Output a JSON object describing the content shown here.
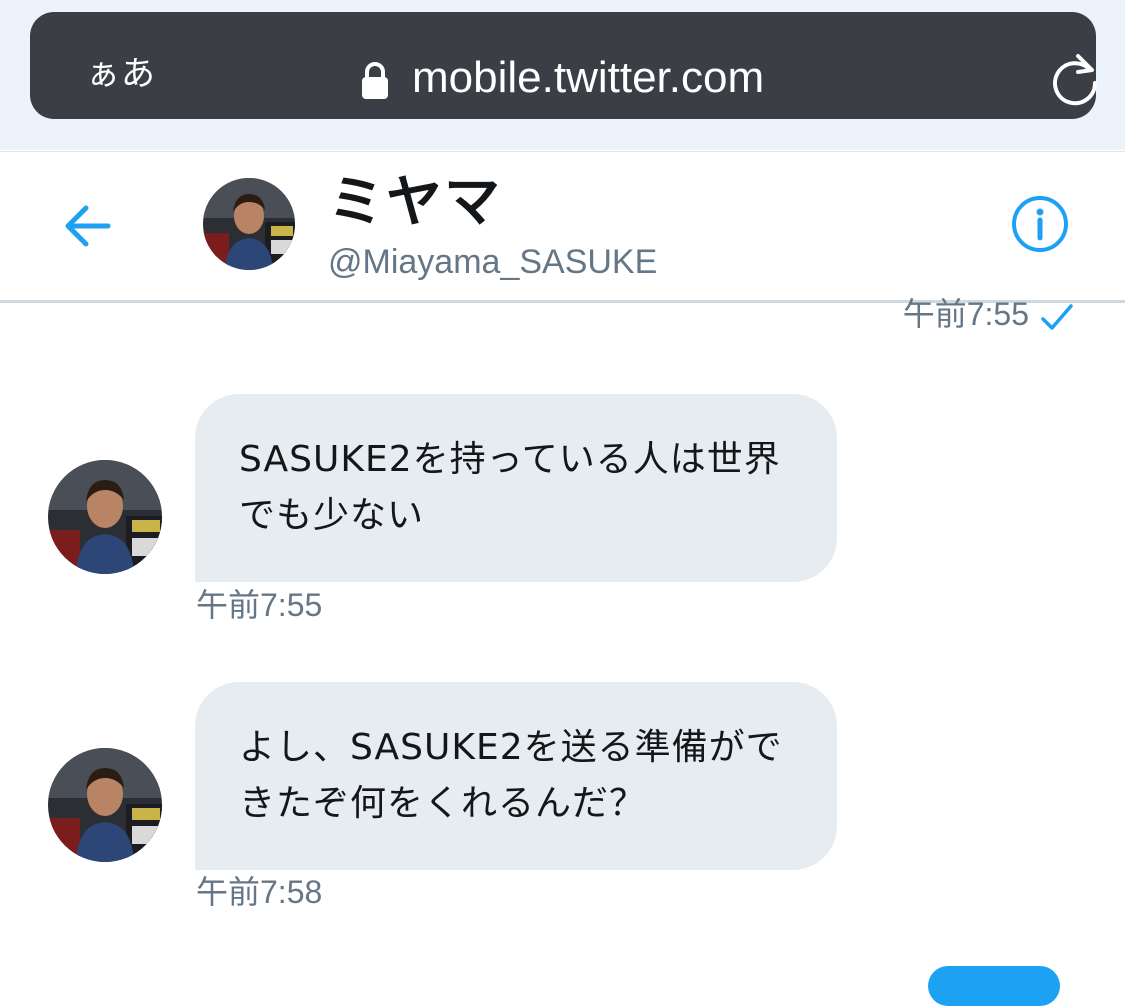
{
  "browser": {
    "text_size_label": "ぁあ",
    "url": "mobile.twitter.com",
    "icons": {
      "lock": "lock-icon",
      "reload": "reload-icon"
    }
  },
  "conversation": {
    "display_name": "ミヤマ",
    "handle": "@Miayama_SASUKE",
    "icons": {
      "back": "back-arrow-icon",
      "info": "info-icon"
    }
  },
  "messages": {
    "sent_time": "午前7:55",
    "received": [
      {
        "text": "SASUKE2を持っている人は世界でも少ない",
        "time": "午前7:55"
      },
      {
        "text": "よし、SASUKE2を送る準備ができたぞ何をくれるんだ？",
        "time": "午前7:58"
      }
    ]
  },
  "colors": {
    "accent": "#1da1f2",
    "bubble": "#e6ecf0",
    "muted_text": "#657786",
    "url_bar": "#3b3f45"
  }
}
